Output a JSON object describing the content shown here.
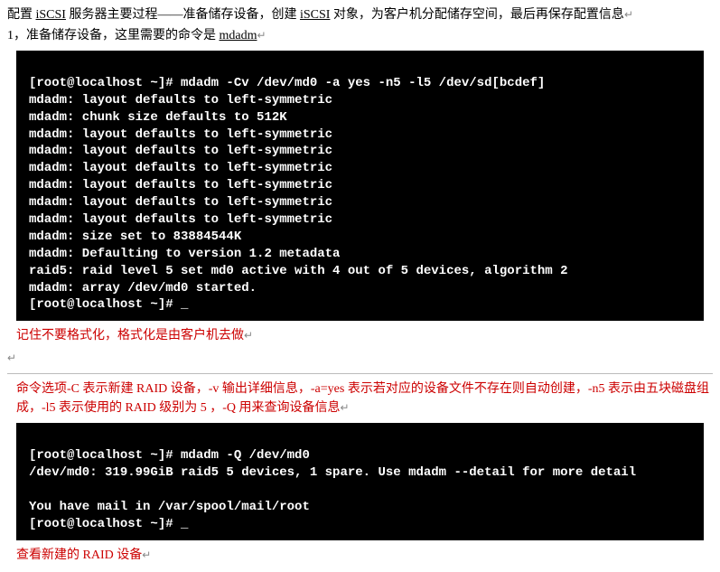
{
  "intro": {
    "line1_a": "配置 ",
    "line1_b": "iSCSI",
    "line1_c": " 服务器主要过程——准备储存设备，创建 ",
    "line1_d": "iSCSI",
    "line1_e": " 对象，为客户机分配储存空间，最后再保存配置信息",
    "fmark1": "↵",
    "line2_a": "1，准备储存设备，这里需要的命令是 ",
    "line2_b": "mdadm",
    "fmark2": "↵"
  },
  "term1": {
    "l1": "[root@localhost ~]# mdadm -Cv /dev/md0 -a yes -n5 -l5 /dev/sd[bcdef]",
    "l2": "mdadm: layout defaults to left-symmetric",
    "l3": "mdadm: chunk size defaults to 512K",
    "l4": "mdadm: layout defaults to left-symmetric",
    "l5": "mdadm: layout defaults to left-symmetric",
    "l6": "mdadm: layout defaults to left-symmetric",
    "l7": "mdadm: layout defaults to left-symmetric",
    "l8": "mdadm: layout defaults to left-symmetric",
    "l9": "mdadm: layout defaults to left-symmetric",
    "l10": "mdadm: size set to 83884544K",
    "l11": "mdadm: Defaulting to version 1.2 metadata",
    "l12": "raid5: raid level 5 set md0 active with 4 out of 5 devices, algorithm 2",
    "l13": "mdadm: array /dev/md0 started.",
    "l14": "[root@localhost ~]# _"
  },
  "note1": {
    "text": "记住不要格式化，格式化是由客户机去做",
    "fmark": "↵"
  },
  "spacer_fmark": "↵",
  "note2": {
    "line1": "命令选项-C 表示新建 RAID 设备，-v 输出详细信息，-a=yes 表示若对应的设备文件不存在则自动创建，-n5 表示由五块磁盘组成，-l5 表示使用的 RAID 级别为 5 ，-Q 用来查询设备信息",
    "fmark": "↵"
  },
  "term2": {
    "l1": "[root@localhost ~]# mdadm -Q /dev/md0",
    "l2": "/dev/md0: 319.99GiB raid5 5 devices, 1 spare. Use mdadm --detail for more detail",
    "l3": "",
    "l4": "You have mail in /var/spool/mail/root",
    "l5": "[root@localhost ~]# _"
  },
  "note3": {
    "text": "查看新建的 RAID 设备",
    "fmark": "↵"
  }
}
